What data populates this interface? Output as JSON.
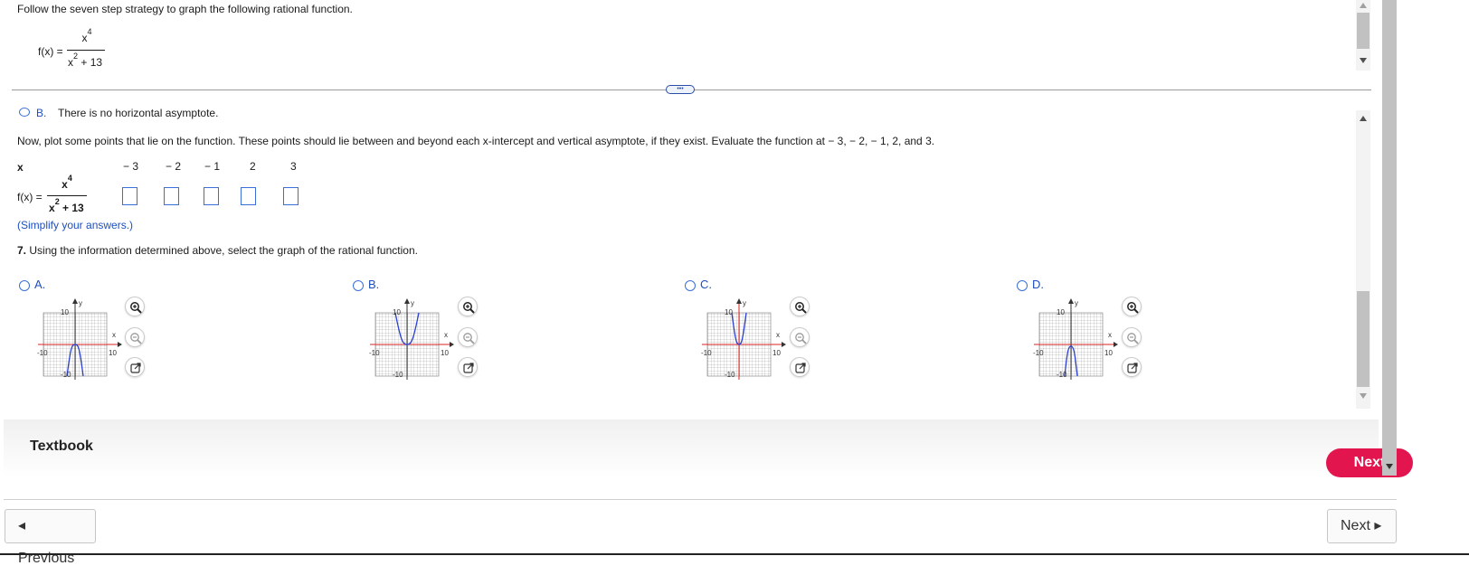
{
  "top_panel": {
    "instruction": "Follow the seven step strategy to graph the following rational function.",
    "func_name": "f(x) =",
    "numerator_base": "x",
    "numerator_exp": "4",
    "denominator_base": "x",
    "denominator_exp": "2",
    "denominator_rest": " + 13"
  },
  "splitter_handle": "•••",
  "step_b": {
    "letter": "B.",
    "text": "There is no horizontal asymptote."
  },
  "plot_points_text": "Now, plot some points that lie on the function. These points should lie between and beyond each x-intercept and vertical asymptote, if they exist. Evaluate the function at  − 3,  − 2,  − 1, 2, and 3.",
  "table": {
    "x_header": "x",
    "x_values": [
      "− 3",
      "− 2",
      "− 1",
      "2",
      "3"
    ],
    "fx_label": "f(x) =",
    "numerator_base": "x",
    "numerator_exp": "4",
    "denominator_base": "x",
    "denominator_exp": "2",
    "denominator_rest": " + 13"
  },
  "simplify_note": "(Simplify your answers.)",
  "step7": {
    "number": "7.",
    "text": "Using the information determined above, select the graph of the rational function."
  },
  "options": [
    {
      "letter": "A.",
      "axis_max": "10",
      "axis_min": "-10",
      "x_label": "x",
      "y_label": "y"
    },
    {
      "letter": "B.",
      "axis_max": "10",
      "axis_min": "-10",
      "x_label": "x",
      "y_label": "y"
    },
    {
      "letter": "C.",
      "axis_max": "10",
      "axis_min": "-10",
      "x_label": "x",
      "y_label": "y"
    },
    {
      "letter": "D.",
      "axis_max": "10",
      "axis_min": "-10",
      "x_label": "x",
      "y_label": "y"
    }
  ],
  "footer": {
    "textbook": "Textbook",
    "next_pill": "Next"
  },
  "bottom_nav": {
    "previous": "◂ Previous",
    "next": "Next ▸"
  },
  "colors": {
    "accent_blue": "#3a6fd8",
    "next_pink": "#e3154f",
    "curve_blue": "#2b3fd1",
    "axis_red": "#d22"
  }
}
